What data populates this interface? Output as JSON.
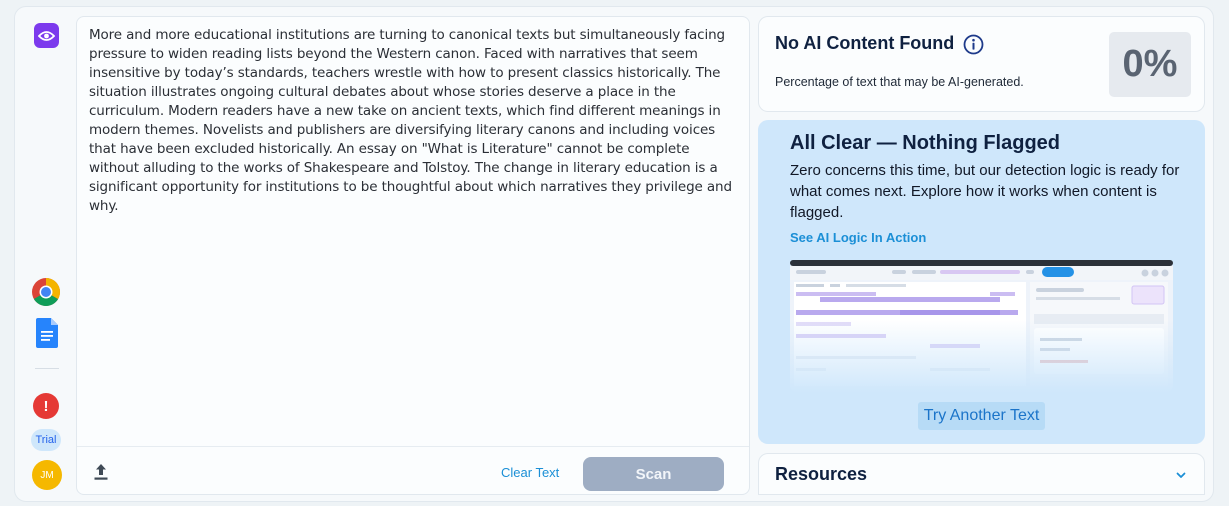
{
  "sidebar": {
    "items": [
      {
        "name": "eye",
        "icon": "eye-icon"
      },
      {
        "name": "chrome",
        "icon": "chrome-icon"
      },
      {
        "name": "docs",
        "icon": "google-docs-icon"
      },
      {
        "name": "alert",
        "icon": "alert-icon",
        "label": "!"
      },
      {
        "name": "trial",
        "label": "Trial"
      },
      {
        "name": "avatar",
        "label": "JM"
      }
    ]
  },
  "editor": {
    "text": "More and more educational institutions are turning to canonical texts but simultaneously facing pressure to widen reading lists beyond the Western canon. Faced with narratives that seem insensitive by today’s standards, teachers wrestle with how to present classics historically. The situation illustrates ongoing cultural debates about whose stories deserve a place in the curriculum. Modern readers have a new take on ancient texts, which find different meanings in modern themes. Novelists and publishers are diversifying literary canons and including voices that have been excluded historically. An essay on \"What is Literature\" cannot be complete without alluding to the works of Shakespeare and Tolstoy. The change in literary education is a significant opportunity for institutions to be thoughtful about which narratives they privilege and why.",
    "upload_icon": "upload-icon",
    "clear_label": "Clear Text",
    "scan_label": "Scan"
  },
  "result": {
    "title": "No AI Content Found",
    "info_icon": "info-icon",
    "subtitle": "Percentage of text that may be AI-generated.",
    "percent": "0%"
  },
  "all_clear": {
    "title": "All Clear — Nothing Flagged",
    "body": "Zero concerns this time, but our detection logic is ready for what comes next. Explore how it works when content is flagged.",
    "link": "See AI Logic In Action",
    "button": "Try Another Text"
  },
  "resources": {
    "title": "Resources",
    "chevron_icon": "chevron-down-icon"
  },
  "colors": {
    "accent_purple": "#7c3aed",
    "link_blue": "#1b8fd6",
    "card_blue": "#cfe7fb",
    "scan_disabled": "#9eadc3",
    "title_navy": "#0f2140"
  }
}
